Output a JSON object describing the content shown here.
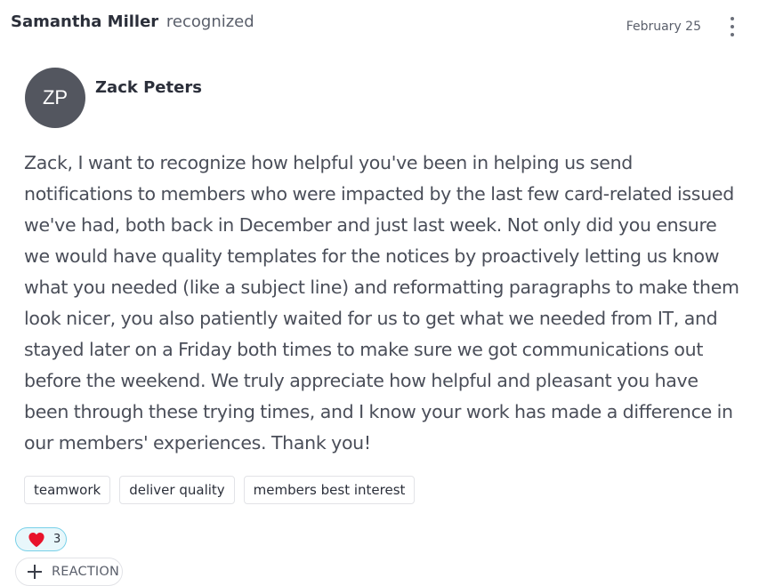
{
  "header": {
    "giver_name": "Samantha Miller",
    "verb": "recognized",
    "date": "February 25",
    "more_icon": "more-vertical-icon"
  },
  "recipient": {
    "initials": "ZP",
    "name": "Zack Peters",
    "avatar_color": "#53565f"
  },
  "message": "Zack, I want to recognize how helpful you've been in helping us send notifications to members who were impacted by the last few card-related issued we've had, both back in December and just last week. Not only did you ensure we would have quality templates for the notices by proactively letting us know what you needed (like a subject line) and reformatting paragraphs to make them look nicer, you also patiently waited for us to get what we needed from IT, and stayed later on a Friday both times to make sure we got communications out before the weekend. We truly appreciate how helpful and pleasant you have been through these trying times, and I know your work has made a difference in our members' experiences. Thank you!",
  "tags": [
    "teamwork",
    "deliver quality",
    "members best interest"
  ],
  "reactions": {
    "heart": {
      "icon": "heart-icon",
      "count": "3",
      "color": "#e8132b"
    },
    "add_label": "REACTION",
    "add_icon": "plus-icon"
  }
}
